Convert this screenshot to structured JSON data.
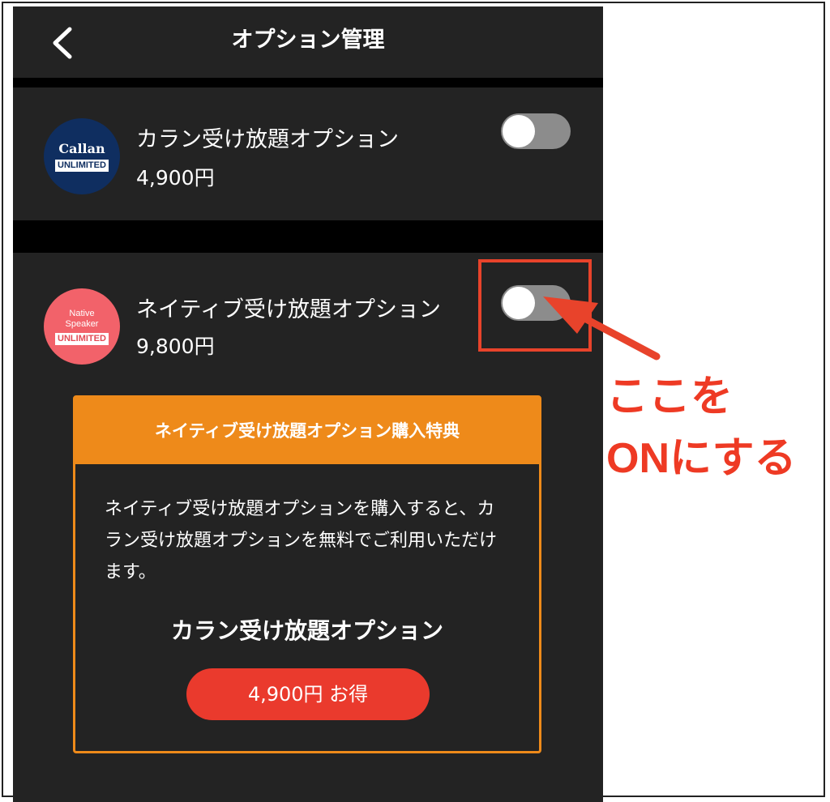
{
  "header": {
    "title": "オプション管理"
  },
  "options": [
    {
      "badge_title": "Callan",
      "badge_tag": "UNLIMITED",
      "name": "カラン受け放題オプション",
      "price": "4,900円",
      "enabled": false
    },
    {
      "badge_line1": "Native",
      "badge_line2": "Speaker",
      "badge_tag": "UNLIMITED",
      "name": "ネイティブ受け放題オプション",
      "price": "9,800円",
      "enabled": false
    }
  ],
  "benefit": {
    "title": "ネイティブ受け放題オプション購入特典",
    "description": "ネイティブ受け放題オプションを購入すると、カラン受け放題オプションを無料でご利用いただけます。",
    "subtitle": "カラン受け放題オプション",
    "button_label": "4,900円 お得"
  },
  "annotation": {
    "line1": "ここを",
    "line2": "ONにする"
  },
  "colors": {
    "background": "#232323",
    "separator": "#000000",
    "accent_orange": "#ee8a1a",
    "button_red": "#ea3a2d",
    "annotation_red": "#e8432b",
    "toggle_off": "#8c8c8c",
    "callan_badge": "#0f2e60",
    "native_badge": "#f2626a"
  },
  "icons": {
    "back": "chevron-left-icon"
  }
}
